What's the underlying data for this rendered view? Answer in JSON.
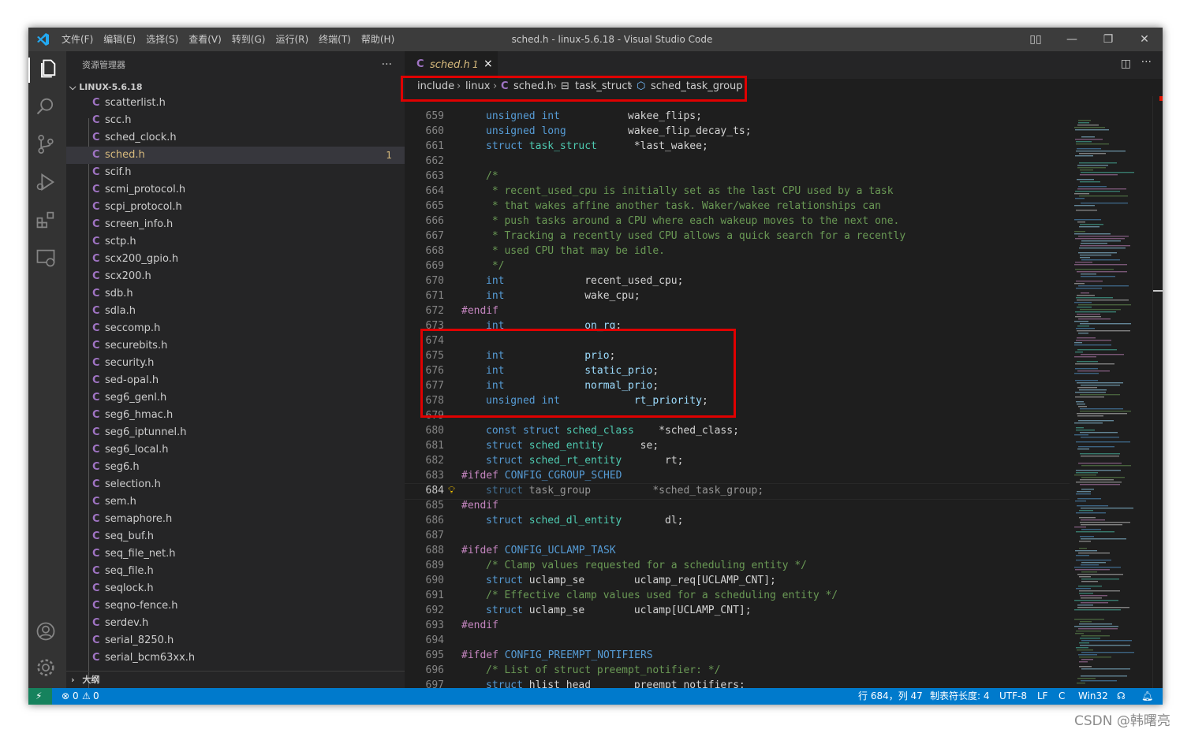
{
  "titlebar": {
    "menu": [
      "文件(F)",
      "编辑(E)",
      "选择(S)",
      "查看(V)",
      "转到(G)",
      "运行(R)",
      "终端(T)",
      "帮助(H)"
    ],
    "window_title": "sched.h - linux-5.6.18 - Visual Studio Code"
  },
  "sidebar": {
    "title": "资源管理器",
    "more": "···",
    "root": "LINUX-5.6.18",
    "outline": "大纲",
    "active_badge": "1",
    "files": [
      "scatterlist.h",
      "scc.h",
      "sched_clock.h",
      "sched.h",
      "scif.h",
      "scmi_protocol.h",
      "scpi_protocol.h",
      "screen_info.h",
      "sctp.h",
      "scx200_gpio.h",
      "scx200.h",
      "sdb.h",
      "sdla.h",
      "seccomp.h",
      "securebits.h",
      "security.h",
      "sed-opal.h",
      "seg6_genl.h",
      "seg6_hmac.h",
      "seg6_iptunnel.h",
      "seg6_local.h",
      "seg6.h",
      "selection.h",
      "sem.h",
      "semaphore.h",
      "seq_buf.h",
      "seq_file_net.h",
      "seq_file.h",
      "seqlock.h",
      "seqno-fence.h",
      "serdev.h",
      "serial_8250.h",
      "serial_bcm63xx.h"
    ],
    "file_letter": "C"
  },
  "tab": {
    "letter": "C",
    "title": "sched.h",
    "modified": "1",
    "close": "×"
  },
  "breadcrumb": [
    "include",
    "linux",
    "sched.h",
    "task_struct",
    "sched_task_group"
  ],
  "editor": {
    "current_line": 684,
    "lines": [
      {
        "n": 659,
        "t": [
          [
            "kw",
            "unsigned int"
          ],
          [
            "",
            "           wakee_flips;"
          ]
        ]
      },
      {
        "n": 660,
        "t": [
          [
            "kw",
            "unsigned long"
          ],
          [
            "",
            "          wakee_flip_decay_ts;"
          ]
        ]
      },
      {
        "n": 661,
        "t": [
          [
            "kw",
            "struct"
          ],
          [
            "",
            " "
          ],
          [
            "ty",
            "task_struct"
          ],
          [
            "",
            "      *last_wakee;"
          ]
        ]
      },
      {
        "n": 662,
        "t": []
      },
      {
        "n": 663,
        "t": [
          [
            "cm",
            "/*"
          ]
        ]
      },
      {
        "n": 664,
        "t": [
          [
            "cm",
            " * recent_used_cpu is initially set as the last CPU used by a task"
          ]
        ]
      },
      {
        "n": 665,
        "t": [
          [
            "cm",
            " * that wakes affine another task. Waker/wakee relationships can"
          ]
        ]
      },
      {
        "n": 666,
        "t": [
          [
            "cm",
            " * push tasks around a CPU where each wakeup moves to the next one."
          ]
        ]
      },
      {
        "n": 667,
        "t": [
          [
            "cm",
            " * Tracking a recently used CPU allows a quick search for a recently"
          ]
        ]
      },
      {
        "n": 668,
        "t": [
          [
            "cm",
            " * used CPU that may be idle."
          ]
        ]
      },
      {
        "n": 669,
        "t": [
          [
            "cm",
            " */"
          ]
        ]
      },
      {
        "n": 670,
        "t": [
          [
            "kw",
            "int"
          ],
          [
            "",
            "             recent_used_cpu;"
          ]
        ]
      },
      {
        "n": 671,
        "t": [
          [
            "kw",
            "int"
          ],
          [
            "",
            "             wake_cpu;"
          ]
        ]
      },
      {
        "n": 672,
        "pre": true,
        "t": [
          [
            "pp",
            "#endif"
          ]
        ]
      },
      {
        "n": 673,
        "t": [
          [
            "kw",
            "int"
          ],
          [
            "",
            "             "
          ],
          [
            "var",
            "on_rq"
          ],
          [
            "",
            ";"
          ]
        ]
      },
      {
        "n": 674,
        "t": []
      },
      {
        "n": 675,
        "t": [
          [
            "kw",
            "int"
          ],
          [
            "",
            "             "
          ],
          [
            "var",
            "prio"
          ],
          [
            "",
            ";"
          ]
        ]
      },
      {
        "n": 676,
        "t": [
          [
            "kw",
            "int"
          ],
          [
            "",
            "             "
          ],
          [
            "var",
            "static_prio"
          ],
          [
            "",
            ";"
          ]
        ]
      },
      {
        "n": 677,
        "t": [
          [
            "kw",
            "int"
          ],
          [
            "",
            "             "
          ],
          [
            "var",
            "normal_prio"
          ],
          [
            "",
            ";"
          ]
        ]
      },
      {
        "n": 678,
        "t": [
          [
            "kw",
            "unsigned int"
          ],
          [
            "",
            "            "
          ],
          [
            "var",
            "rt_priority"
          ],
          [
            "",
            ";"
          ]
        ]
      },
      {
        "n": 679,
        "t": []
      },
      {
        "n": 680,
        "t": [
          [
            "kw",
            "const struct"
          ],
          [
            "",
            " "
          ],
          [
            "ty",
            "sched_class"
          ],
          [
            "",
            "    *sched_class;"
          ]
        ]
      },
      {
        "n": 681,
        "t": [
          [
            "kw",
            "struct"
          ],
          [
            "",
            " "
          ],
          [
            "ty",
            "sched_entity"
          ],
          [
            "",
            "      se;"
          ]
        ]
      },
      {
        "n": 682,
        "t": [
          [
            "kw",
            "struct"
          ],
          [
            "",
            " "
          ],
          [
            "ty",
            "sched_rt_entity"
          ],
          [
            "",
            "       rt;"
          ]
        ]
      },
      {
        "n": 683,
        "pre": true,
        "t": [
          [
            "pp",
            "#ifdef"
          ],
          [
            "",
            " "
          ],
          [
            "mac",
            "CONFIG_CGROUP_SCHED"
          ]
        ]
      },
      {
        "n": 684,
        "dim": true,
        "t": [
          [
            "kw",
            "struct"
          ],
          [
            "",
            " "
          ],
          [
            "",
            "task_group          *sched_task_group;"
          ]
        ]
      },
      {
        "n": 685,
        "pre": true,
        "t": [
          [
            "pp",
            "#endif"
          ]
        ]
      },
      {
        "n": 686,
        "t": [
          [
            "kw",
            "struct"
          ],
          [
            "",
            " "
          ],
          [
            "ty",
            "sched_dl_entity"
          ],
          [
            "",
            "       dl;"
          ]
        ]
      },
      {
        "n": 687,
        "t": []
      },
      {
        "n": 688,
        "pre": true,
        "t": [
          [
            "pp",
            "#ifdef"
          ],
          [
            "",
            " "
          ],
          [
            "mac",
            "CONFIG_UCLAMP_TASK"
          ]
        ]
      },
      {
        "n": 689,
        "t": [
          [
            "cm",
            "/* Clamp values requested for a scheduling entity */"
          ]
        ]
      },
      {
        "n": 690,
        "t": [
          [
            "kw",
            "struct"
          ],
          [
            "",
            " uclamp_se        uclamp_req[UCLAMP_CNT];"
          ]
        ]
      },
      {
        "n": 691,
        "t": [
          [
            "cm",
            "/* Effective clamp values used for a scheduling entity */"
          ]
        ]
      },
      {
        "n": 692,
        "t": [
          [
            "kw",
            "struct"
          ],
          [
            "",
            " uclamp_se        uclamp[UCLAMP_CNT];"
          ]
        ]
      },
      {
        "n": 693,
        "pre": true,
        "t": [
          [
            "pp",
            "#endif"
          ]
        ]
      },
      {
        "n": 694,
        "t": []
      },
      {
        "n": 695,
        "pre": true,
        "t": [
          [
            "pp",
            "#ifdef"
          ],
          [
            "",
            " "
          ],
          [
            "mac",
            "CONFIG_PREEMPT_NOTIFIERS"
          ]
        ]
      },
      {
        "n": 696,
        "t": [
          [
            "cm",
            "/* List of struct preempt_notifier: */"
          ]
        ]
      },
      {
        "n": 697,
        "t": [
          [
            "kw",
            "struct"
          ],
          [
            "",
            " hlist_head       preempt_notifiers;"
          ]
        ]
      }
    ]
  },
  "statusbar": {
    "errors": "0",
    "warnings": "0",
    "position": "行 684，列 47",
    "indent": "制表符长度: 4",
    "encoding": "UTF-8",
    "eol": "LF",
    "language": "C",
    "platform": "Win32"
  },
  "watermark": "CSDN @韩曙亮"
}
